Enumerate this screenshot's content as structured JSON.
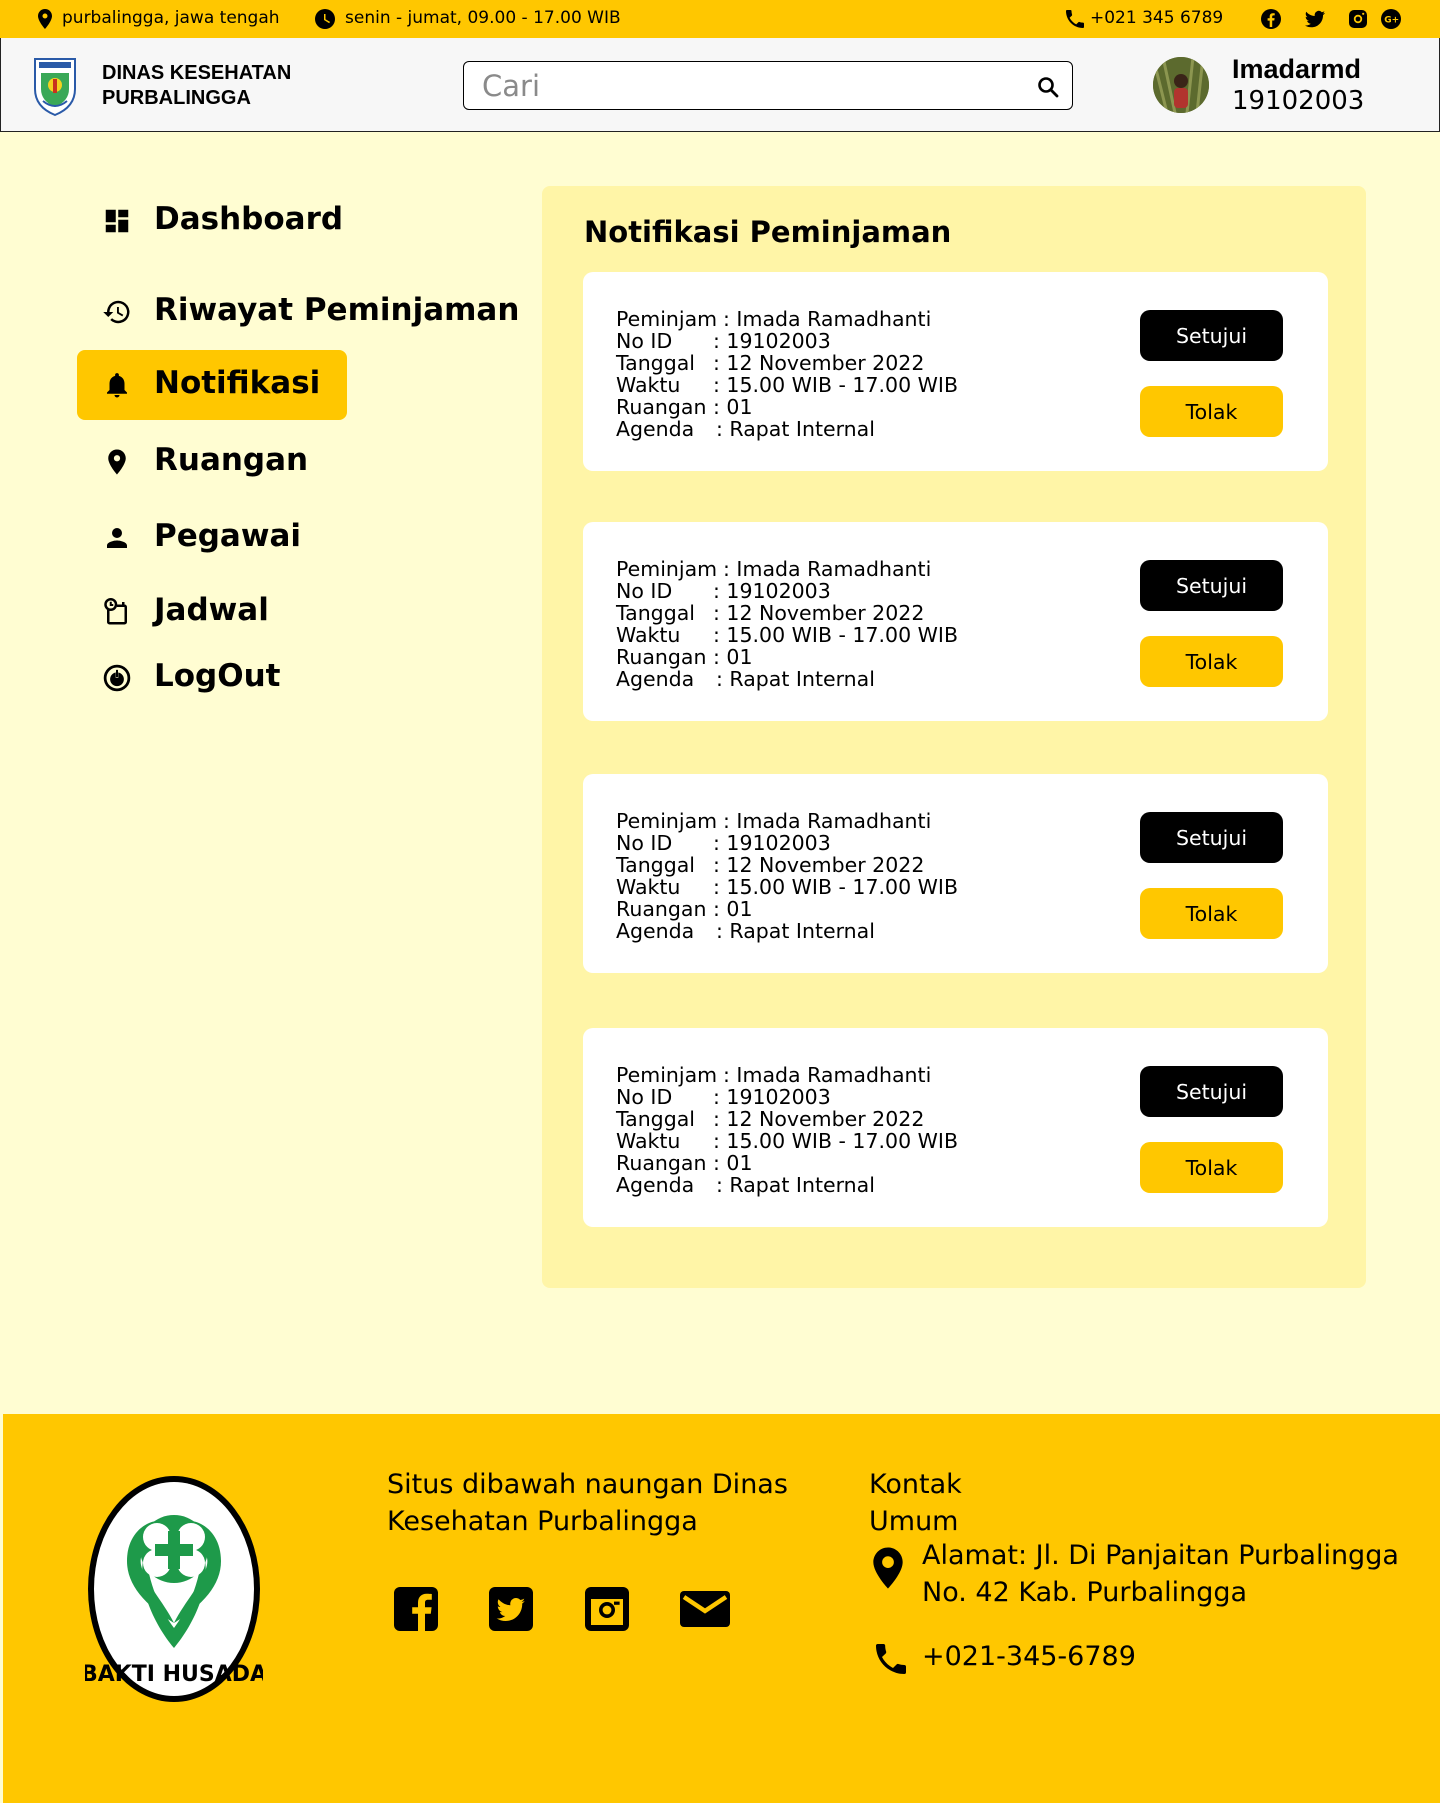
{
  "topbar": {
    "location": "purbalingga,  jawa tengah",
    "hours": "senin - jumat, 09.00 - 17.00 WIB",
    "phone": "+021 345 6789",
    "socials": [
      "facebook-icon",
      "twitter-icon",
      "instagram-icon",
      "google-plus-icon"
    ]
  },
  "header": {
    "org_line1": "DINAS KESEHATAN",
    "org_line2": "PURBALINGGA",
    "search_placeholder": "Cari",
    "user_name": "Imadarmd",
    "user_id": "19102003"
  },
  "sidebar": {
    "items": [
      {
        "label": "Dashboard",
        "icon": "dashboard-icon"
      },
      {
        "label": "Riwayat Peminjaman",
        "icon": "history-icon"
      },
      {
        "label": "Notifikasi",
        "icon": "bell-icon",
        "active": true
      },
      {
        "label": "Ruangan",
        "icon": "location-pin-icon"
      },
      {
        "label": "Pegawai",
        "icon": "person-icon"
      },
      {
        "label": "Jadwal",
        "icon": "schedule-icon"
      },
      {
        "label": "LogOut",
        "icon": "power-icon"
      }
    ]
  },
  "main": {
    "title": "Notifikasi Peminjaman",
    "field_labels": {
      "borrower": "Peminjam",
      "id": "No ID",
      "date": "Tanggal",
      "time": "Waktu",
      "room": "Ruangan",
      "agenda": "Agenda"
    },
    "approve_label": "Setujui",
    "reject_label": "Tolak",
    "notifications": [
      {
        "borrower": ": Imada Ramadhanti",
        "id": ": 19102003",
        "date": ": 12 November 2022",
        "time": ": 15.00 WIB - 17.00 WIB",
        "room": ": 01",
        "agenda": ": Rapat Internal"
      },
      {
        "borrower": ": Imada Ramadhanti",
        "id": ": 19102003",
        "date": ": 12 November 2022",
        "time": ": 15.00 WIB - 17.00 WIB",
        "room": ": 01",
        "agenda": ": Rapat Internal"
      },
      {
        "borrower": ": Imada Ramadhanti",
        "id": ": 19102003",
        "date": ": 12 November 2022",
        "time": ": 15.00 WIB - 17.00 WIB",
        "room": ": 01",
        "agenda": ": Rapat Internal"
      },
      {
        "borrower": ": Imada Ramadhanti",
        "id": ": 19102003",
        "date": ": 12 November 2022",
        "time": ": 15.00 WIB - 17.00 WIB",
        "room": ": 01",
        "agenda": ": Rapat Internal"
      }
    ]
  },
  "footer": {
    "logo_text": "BAKTI HUSADA",
    "about_line1": "Situs dibawah naungan Dinas",
    "about_line2": "Kesehatan Purbalingga",
    "contact_title_line1": "Kontak",
    "contact_title_line2": "Umum",
    "address_line1": "Alamat: Jl. Di Panjaitan Purbalingga",
    "address_line2": "No. 42 Kab. Purbalingga",
    "phone": "+021-345-6789",
    "socials": [
      "facebook-icon",
      "twitter-icon",
      "instagram-icon",
      "mail-icon"
    ]
  },
  "colors": {
    "accent": "#FFC700",
    "page_bg": "#FFFDD2",
    "panel_bg": "#FFF5A7",
    "logo_green": "#1E9A4A"
  }
}
